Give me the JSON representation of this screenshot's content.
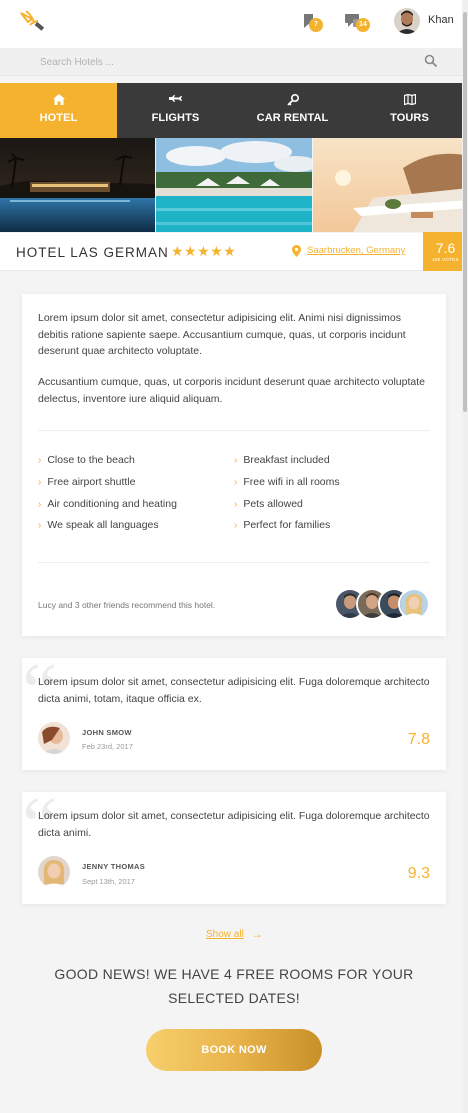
{
  "header": {
    "logo_icon": "torch-logo-icon",
    "bookmark_count": "7",
    "messages_count": "14",
    "username": "Khan"
  },
  "search": {
    "placeholder": "Search Hotels ...",
    "value": ""
  },
  "tabs": [
    {
      "label": "HOTEL",
      "icon": "home-icon",
      "active": true
    },
    {
      "label": "FLIGHTS",
      "icon": "plane-icon",
      "active": false
    },
    {
      "label": "CAR RENTAL",
      "icon": "key-icon",
      "active": false
    },
    {
      "label": "TOURS",
      "icon": "map-icon",
      "active": false
    }
  ],
  "hotel": {
    "name": "HOTEL LAS GERMAN",
    "stars": "★★★★★",
    "location": "Saarbrucken, Germany",
    "rating": "7.6",
    "rating_label": "488 VOTES"
  },
  "description": {
    "p1": "Lorem ipsum dolor sit amet, consectetur adipisicing elit. Animi nisi dignissimos debitis ratione sapiente saepe. Accusantium cumque, quas, ut corporis incidunt deserunt quae architecto voluptate.",
    "p2": "Accusantium cumque, quas, ut corporis incidunt deserunt quae architecto voluptate delectus, inventore iure aliquid aliquam.",
    "amenities": [
      "Close to the beach",
      "Breakfast included",
      "Free airport shuttle",
      "Free wifi in all rooms",
      "Air conditioning and heating",
      "Pets allowed",
      "We speak all languages",
      "Perfect for families"
    ],
    "recommend": "Lucy and 3 other friends recommend this hotel."
  },
  "reviews": [
    {
      "text": "Lorem ipsum dolor sit amet, consectetur adipisicing elit. Fuga doloremque architecto dicta animi, totam, itaque officia ex.",
      "name": "JOHN SMOW",
      "date": "Feb 23rd, 2017",
      "score": "7.8"
    },
    {
      "text": "Lorem ipsum dolor sit amet, consectetur adipisicing elit. Fuga doloremque architecto dicta animi.",
      "name": "JENNY THOMAS",
      "date": "Sept 13th, 2017",
      "score": "9.3"
    }
  ],
  "show_all": "Show all",
  "show_all_arrow": "→",
  "good_news": "GOOD NEWS! WE HAVE 4 FREE ROOMS FOR YOUR SELECTED DATES!",
  "book_now": "BOOK NOW",
  "colors": {
    "accent": "#f5b22e",
    "tab_bg": "#3a3a3a"
  }
}
